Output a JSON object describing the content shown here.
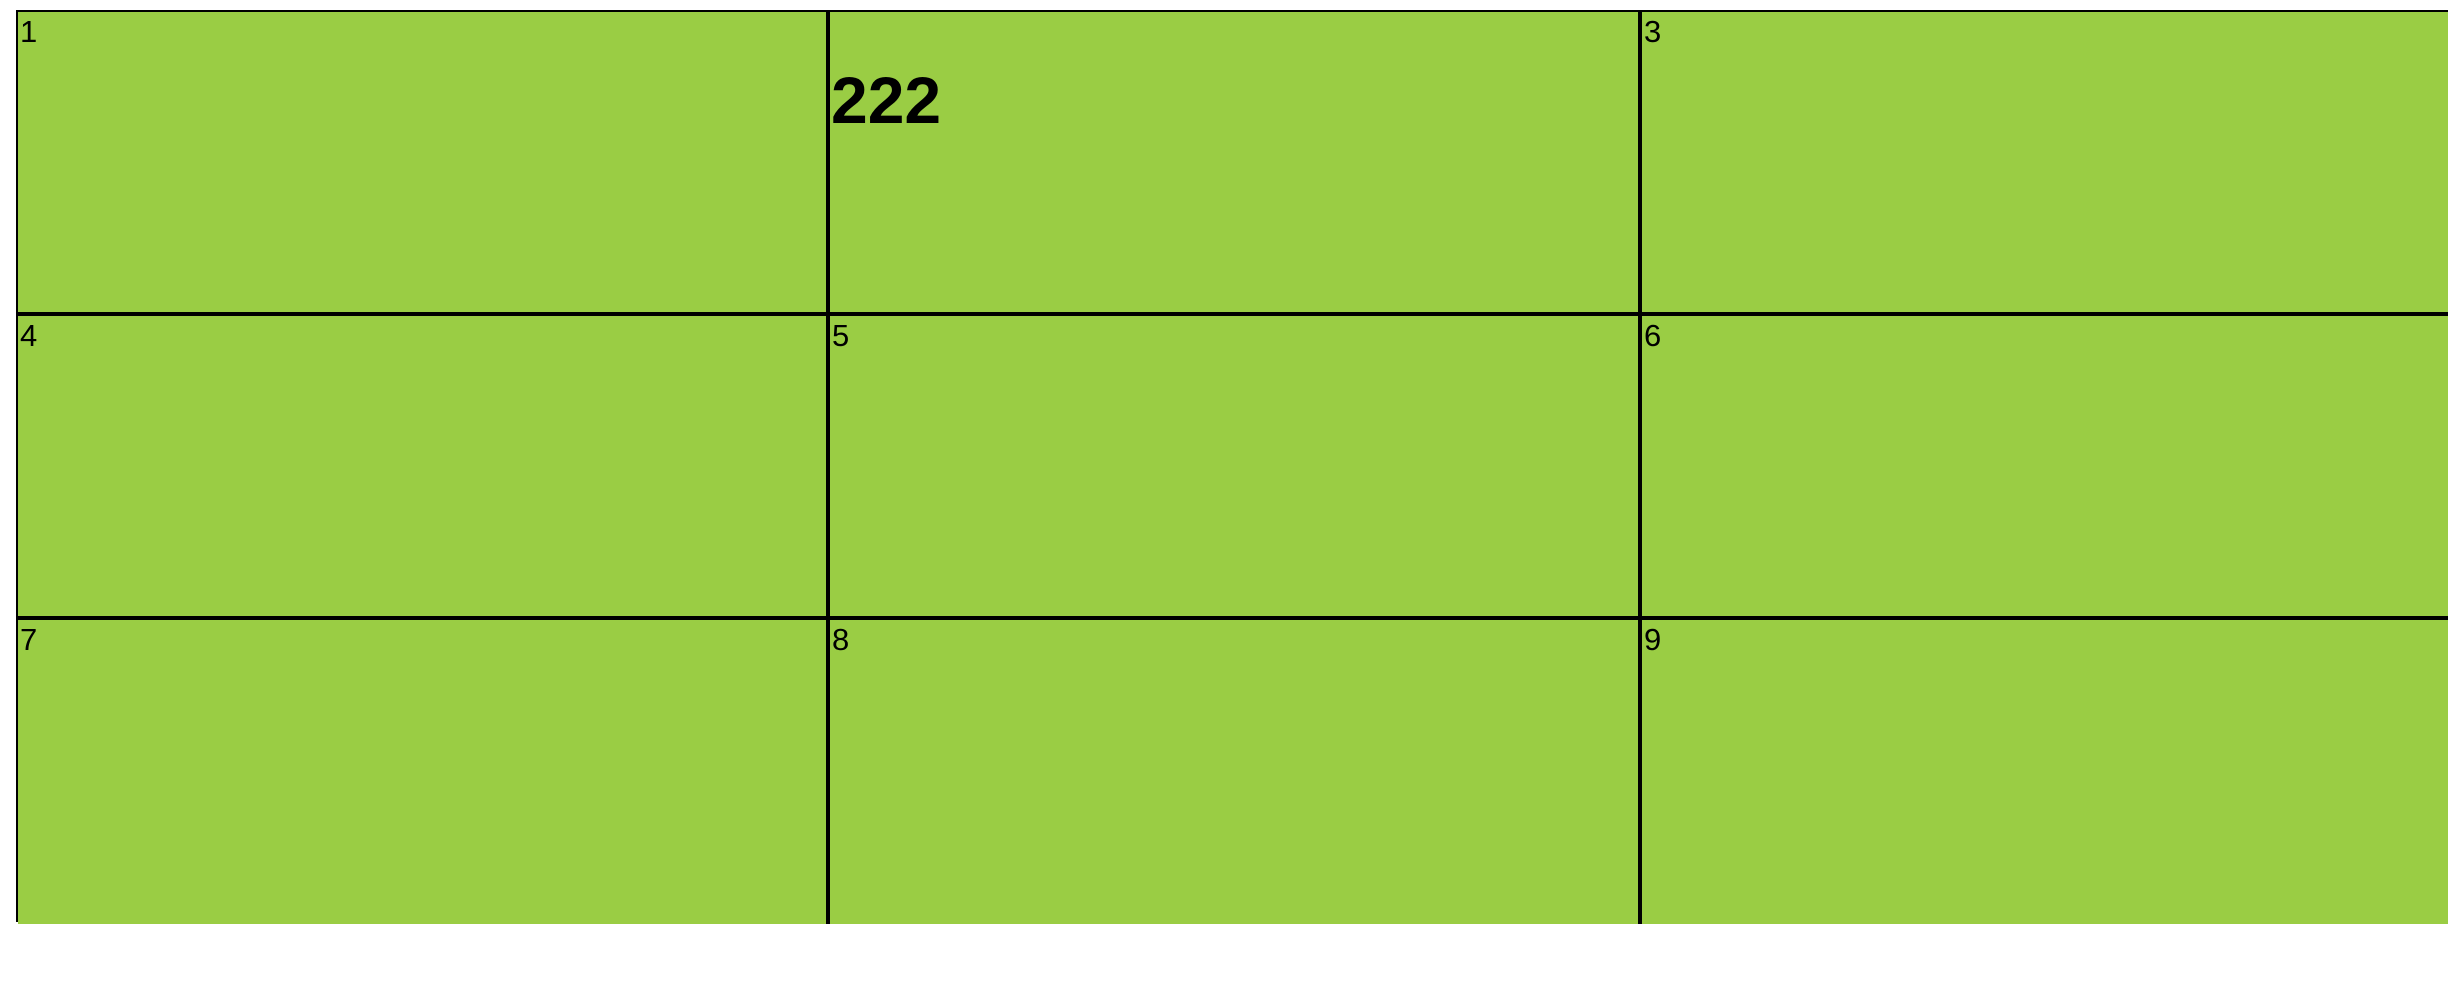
{
  "colors": {
    "cell_background": "#9acd44",
    "border": "#000000"
  },
  "grid": {
    "cells": [
      {
        "label": "1"
      },
      {
        "label": "222",
        "style": "heading"
      },
      {
        "label": "3"
      },
      {
        "label": "4"
      },
      {
        "label": "5"
      },
      {
        "label": "6"
      },
      {
        "label": "7"
      },
      {
        "label": "8"
      },
      {
        "label": "9"
      }
    ]
  }
}
